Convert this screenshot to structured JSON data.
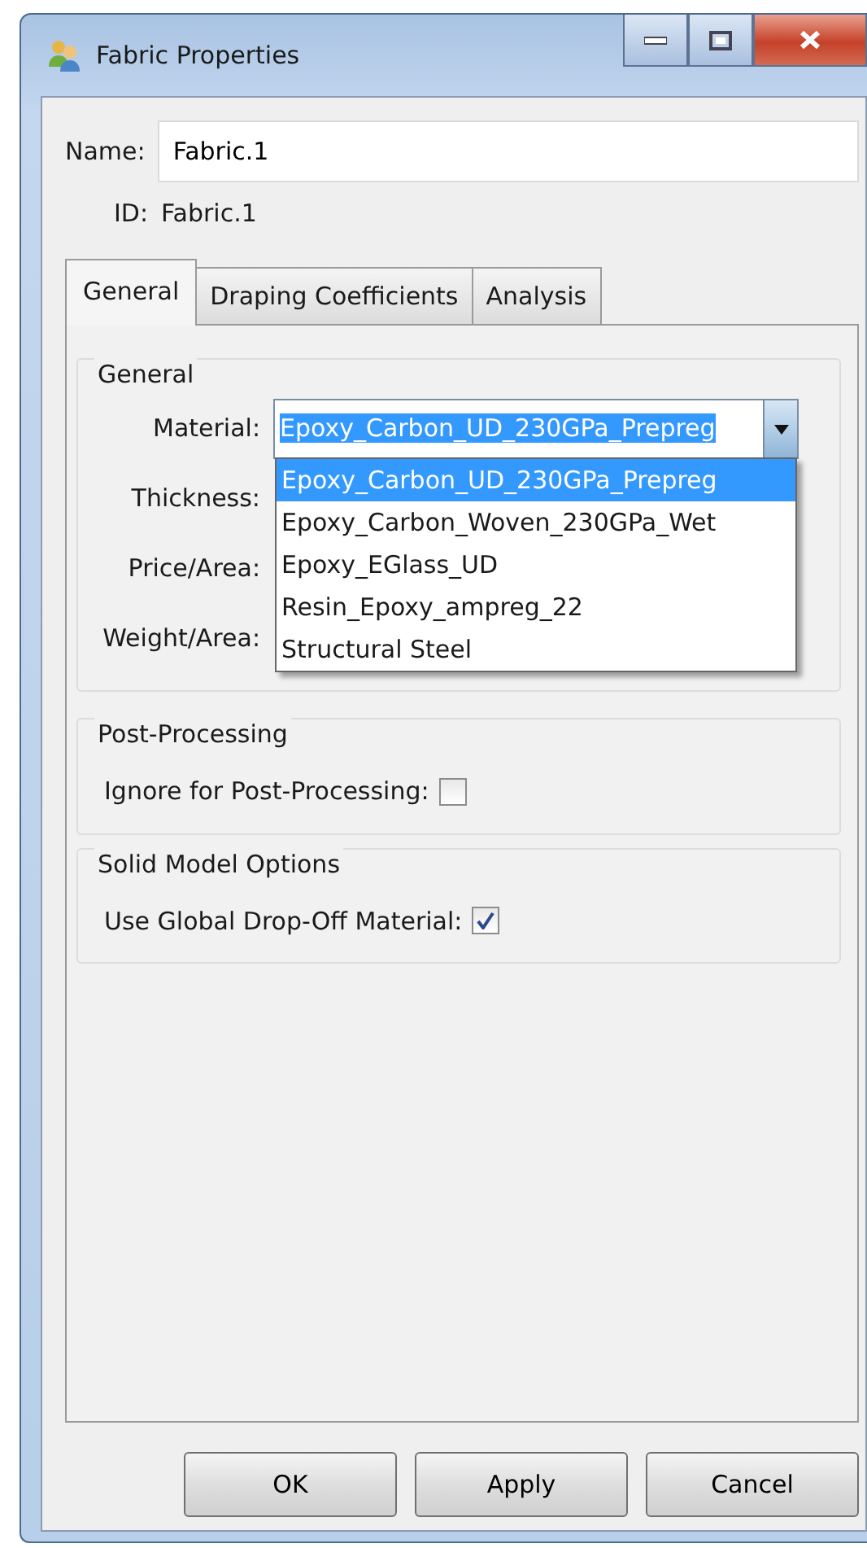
{
  "window": {
    "title": "Fabric Properties"
  },
  "name": {
    "label": "Name:",
    "value": "Fabric.1"
  },
  "id": {
    "label": "ID:",
    "value": "Fabric.1"
  },
  "tabs": [
    {
      "label": "General",
      "selected": true
    },
    {
      "label": "Draping Coefficients",
      "selected": false
    },
    {
      "label": "Analysis",
      "selected": false
    }
  ],
  "general": {
    "title": "General",
    "material": {
      "label": "Material:",
      "value": "Epoxy_Carbon_UD_230GPa_Prepreg",
      "expanded": true,
      "options": [
        {
          "label": "Epoxy_Carbon_UD_230GPa_Prepreg",
          "selected": true
        },
        {
          "label": "Epoxy_Carbon_Woven_230GPa_Wet",
          "selected": false
        },
        {
          "label": "Epoxy_EGlass_UD",
          "selected": false
        },
        {
          "label": "Resin_Epoxy_ampreg_22",
          "selected": false
        },
        {
          "label": "Structural Steel",
          "selected": false
        }
      ]
    },
    "fields": [
      {
        "label": "Thickness:"
      },
      {
        "label": "Price/Area:"
      },
      {
        "label": "Weight/Area:"
      }
    ]
  },
  "groups": [
    {
      "title": "Post-Processing",
      "options": [
        {
          "label": "Ignore for Post-Processing:",
          "checked": false
        }
      ]
    },
    {
      "title": "Solid Model Options",
      "options": [
        {
          "label": "Use Global Drop-Off Material:",
          "checked": true
        }
      ]
    }
  ],
  "buttons": [
    "OK",
    "Apply",
    "Cancel"
  ]
}
